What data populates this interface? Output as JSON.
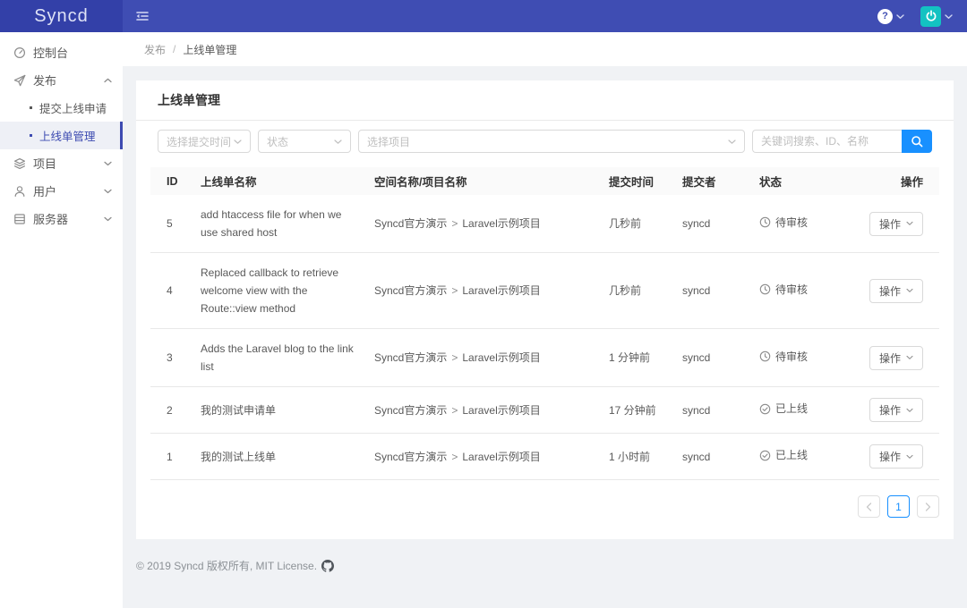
{
  "topbar": {
    "logo": "Syncd"
  },
  "breadcrumb": {
    "section": "发布",
    "separator": "/",
    "page": "上线单管理"
  },
  "sidebar": {
    "items": [
      {
        "label": "控制台",
        "icon": "dashboard-icon"
      },
      {
        "label": "发布",
        "icon": "send-icon",
        "expanded": true,
        "children": [
          {
            "label": "提交上线申请",
            "active": false
          },
          {
            "label": "上线单管理",
            "active": true
          }
        ]
      },
      {
        "label": "项目",
        "icon": "layers-icon"
      },
      {
        "label": "用户",
        "icon": "user-icon"
      },
      {
        "label": "服务器",
        "icon": "server-icon"
      }
    ]
  },
  "card": {
    "title": "上线单管理",
    "filters": {
      "time_placeholder": "选择提交时间",
      "status_placeholder": "状态",
      "project_placeholder": "选择项目",
      "keyword_placeholder": "关键词搜索、ID、名称"
    },
    "table": {
      "columns": [
        "ID",
        "上线单名称",
        "空间名称/项目名称",
        "提交时间",
        "提交者",
        "状态",
        "操作"
      ],
      "space_separator": ">",
      "rows": [
        {
          "id": "5",
          "name": "add htaccess file for when we use shared host",
          "space": "Syncd官方演示",
          "project": "Laravel示例项目",
          "time": "几秒前",
          "submitter": "syncd",
          "status": "待审核",
          "status_icon": "clock-icon",
          "action_label": "操作"
        },
        {
          "id": "4",
          "name": "Replaced callback to retrieve welcome view with the Route::view method",
          "space": "Syncd官方演示",
          "project": "Laravel示例项目",
          "time": "几秒前",
          "submitter": "syncd",
          "status": "待审核",
          "status_icon": "clock-icon",
          "action_label": "操作"
        },
        {
          "id": "3",
          "name": "Adds the Laravel blog to the link list",
          "space": "Syncd官方演示",
          "project": "Laravel示例项目",
          "time": "1 分钟前",
          "submitter": "syncd",
          "status": "待审核",
          "status_icon": "clock-icon",
          "action_label": "操作"
        },
        {
          "id": "2",
          "name": "我的测试申请单",
          "space": "Syncd官方演示",
          "project": "Laravel示例项目",
          "time": "17 分钟前",
          "submitter": "syncd",
          "status": "已上线",
          "status_icon": "check-circle-icon",
          "action_label": "操作"
        },
        {
          "id": "1",
          "name": "我的测试上线单",
          "space": "Syncd官方演示",
          "project": "Laravel示例项目",
          "time": "1 小时前",
          "submitter": "syncd",
          "status": "已上线",
          "status_icon": "check-circle-icon",
          "action_label": "操作"
        }
      ]
    },
    "pagination": {
      "prev": "‹",
      "current": "1",
      "next": "›"
    }
  },
  "footer": {
    "text": "© 2019 Syncd 版权所有, MIT License."
  },
  "colors": {
    "topbar": "#3F4DB3",
    "logo_bg": "#3340A8",
    "accent_blue": "#1890ff",
    "avatar_teal": "#13c2c2",
    "sidebar_active": "#3D4BB1",
    "page_bg": "#f0f2f5"
  }
}
